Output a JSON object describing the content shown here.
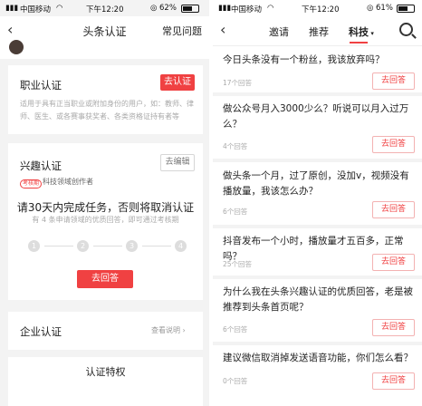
{
  "left": {
    "status": {
      "carrier": "中国移动",
      "time": "下午12:20",
      "battery": "62%"
    },
    "nav": {
      "title": "头条认证",
      "right_label": "常见问题"
    },
    "career": {
      "title": "职业认证",
      "button": "去认证",
      "desc": "适用于具有正当职业或附加身份的用户，如：教师、律师、医生、或各赛事获奖者、各类资格证持有者等"
    },
    "interest": {
      "title": "兴趣认证",
      "edit": "去编辑",
      "badge": "考核期",
      "role": "科技领域创作者",
      "headline": "请30天内完成任务，否则将取消认证",
      "subline": "有 4 条申请领域的优质回答，即可通过考核期",
      "steps": [
        "1",
        "2",
        "3",
        "4"
      ],
      "button": "去回答"
    },
    "enterprise": {
      "title": "企业认证",
      "link": "查看说明 ›"
    },
    "privilege": {
      "title": "认证特权"
    }
  },
  "right": {
    "status": {
      "carrier": "中国移动",
      "time": "下午12:20",
      "battery": "61%"
    },
    "tabs": [
      "邀请",
      "推荐",
      "科技"
    ],
    "questions": [
      {
        "title": "今日头条没有一个粉丝，我该放弃吗？",
        "count": "17个回答",
        "button": "去回答"
      },
      {
        "title": "做公众号月入3000少么？听说可以月入过万么？",
        "count": "4个回答",
        "button": "去回答"
      },
      {
        "title": "做头条一个月，过了原创，没加v，视频没有播放量，我该怎么办？",
        "count": "6个回答",
        "button": "去回答"
      },
      {
        "title": "抖音发布一个小时，播放量才五百多，正常吗？",
        "count": "25个回答",
        "button": "去回答"
      },
      {
        "title": "为什么我在头条兴趣认证的优质回答，老是被推荐到头条首页呢？",
        "count": "6个回答",
        "button": "去回答"
      },
      {
        "title": "建议微信取消掉发送语音功能，你们怎么看？",
        "count": "0个回答",
        "button": "去回答"
      }
    ]
  }
}
